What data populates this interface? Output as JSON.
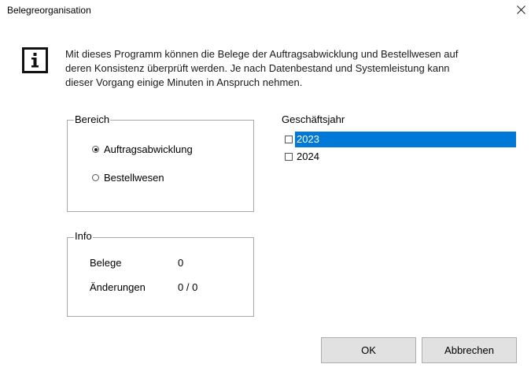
{
  "window": {
    "title": "Belegreorganisation"
  },
  "message": {
    "lines": [
      "Mit dieses Programm können die Belege der Auftragsabwicklung und Bestellwesen auf",
      "deren Konsistenz überprüft werden. Je nach Datenbestand und Systemleistung kann",
      "dieser Vorgang einige Minuten in Anspruch nehmen."
    ]
  },
  "bereich": {
    "label": "Bereich",
    "options": [
      {
        "label": "Auftragsabwicklung",
        "checked": true
      },
      {
        "label": "Bestellwesen",
        "checked": false
      }
    ]
  },
  "info": {
    "label": "Info",
    "rows": [
      {
        "label": "Belege",
        "value": "0"
      },
      {
        "label": "Änderungen",
        "value": "0 / 0"
      }
    ]
  },
  "geschaeftsjahr": {
    "label": "Geschäftsjahr",
    "years": [
      {
        "label": "2023",
        "checked": false,
        "selected": true
      },
      {
        "label": "2024",
        "checked": false,
        "selected": false
      }
    ]
  },
  "buttons": {
    "ok": "OK",
    "cancel": "Abbrechen"
  },
  "colors": {
    "selection": "#0078d7",
    "button_face": "#e1e1e1",
    "group_border": "#a8a8a8"
  }
}
